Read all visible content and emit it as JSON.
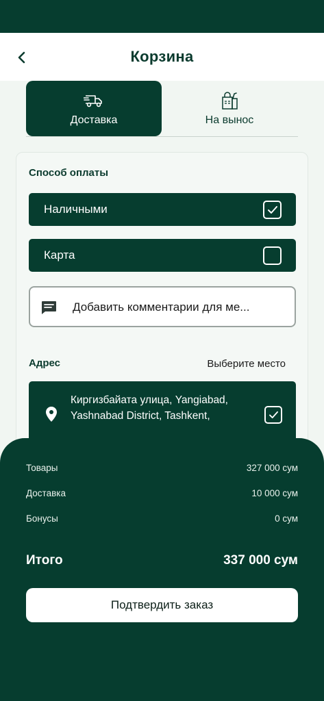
{
  "header": {
    "title": "Корзина"
  },
  "tabs": [
    {
      "label": "Доставка",
      "icon": "delivery-truck-icon",
      "active": true
    },
    {
      "label": "На вынос",
      "icon": "takeaway-bag-icon",
      "active": false
    }
  ],
  "payment": {
    "label": "Способ оплаты",
    "options": [
      {
        "label": "Наличными",
        "checked": true
      },
      {
        "label": "Карта",
        "checked": false
      }
    ]
  },
  "comment": {
    "placeholder": "Добавить комментарии для ме..."
  },
  "address": {
    "label": "Адрес",
    "choose_label": "Выберите место",
    "line1": "Киргизбайата улица, Yangiabad,",
    "line2": "Yashnabad District, Tashkent,",
    "checked": true
  },
  "summary": {
    "items_label": "Товары",
    "items_value": "327 000 сум",
    "delivery_label": "Доставка",
    "delivery_value": "10 000 сум",
    "bonus_label": "Бонусы",
    "bonus_value": "0 сум",
    "total_label": "Итого",
    "total_value": "337 000 сум",
    "confirm_label": "Подтвердить заказ"
  },
  "colors": {
    "primary": "#063d2f",
    "background": "#f1f6f2",
    "white": "#ffffff"
  }
}
